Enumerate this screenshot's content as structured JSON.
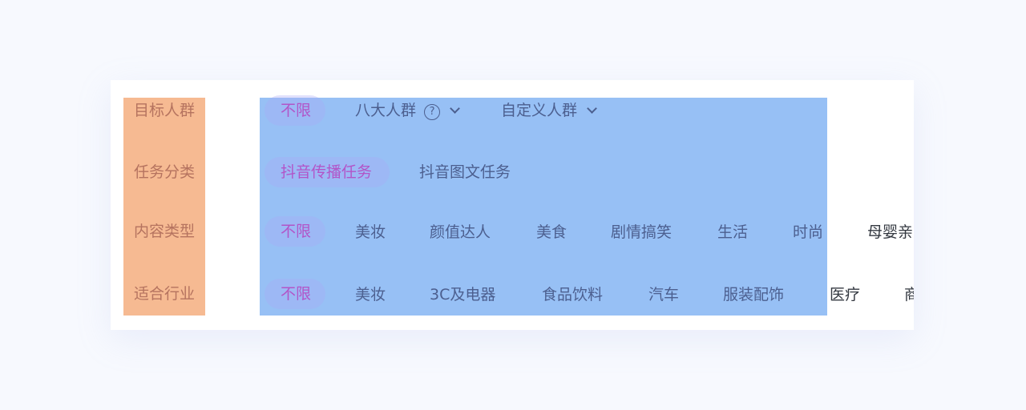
{
  "filters": {
    "rows": [
      {
        "label": "目标人群",
        "options": [
          {
            "text": "不限",
            "selected": true
          },
          {
            "text": "八大人群",
            "has_help_icon": true,
            "has_dropdown": true
          },
          {
            "text": "自定义人群",
            "has_dropdown": true
          }
        ]
      },
      {
        "label": "任务分类",
        "options": [
          {
            "text": "抖音传播任务",
            "selected": true
          },
          {
            "text": "抖音图文任务"
          }
        ]
      },
      {
        "label": "内容类型",
        "options": [
          {
            "text": "不限",
            "selected": true
          },
          {
            "text": "美妆"
          },
          {
            "text": "颜值达人"
          },
          {
            "text": "美食"
          },
          {
            "text": "剧情搞笑"
          },
          {
            "text": "生活"
          },
          {
            "text": "时尚"
          },
          {
            "text": "母婴亲"
          }
        ]
      },
      {
        "label": "适合行业",
        "options": [
          {
            "text": "不限",
            "selected": true
          },
          {
            "text": "美妆"
          },
          {
            "text": "3C及电器"
          },
          {
            "text": "食品饮料"
          },
          {
            "text": "汽车"
          },
          {
            "text": "服装配饰"
          },
          {
            "text": "医疗"
          },
          {
            "text": "商"
          }
        ]
      }
    ],
    "help_symbol": "?",
    "icons": {
      "help": "help-circle-icon",
      "dropdown": "chevron-down-icon"
    },
    "colors": {
      "page_background": "#f7f9fe",
      "label_overlay": "#f6ba92",
      "options_overlay": "#97c0f5",
      "selected_text": "#b255c8",
      "option_text": "#4c5f8f"
    }
  }
}
